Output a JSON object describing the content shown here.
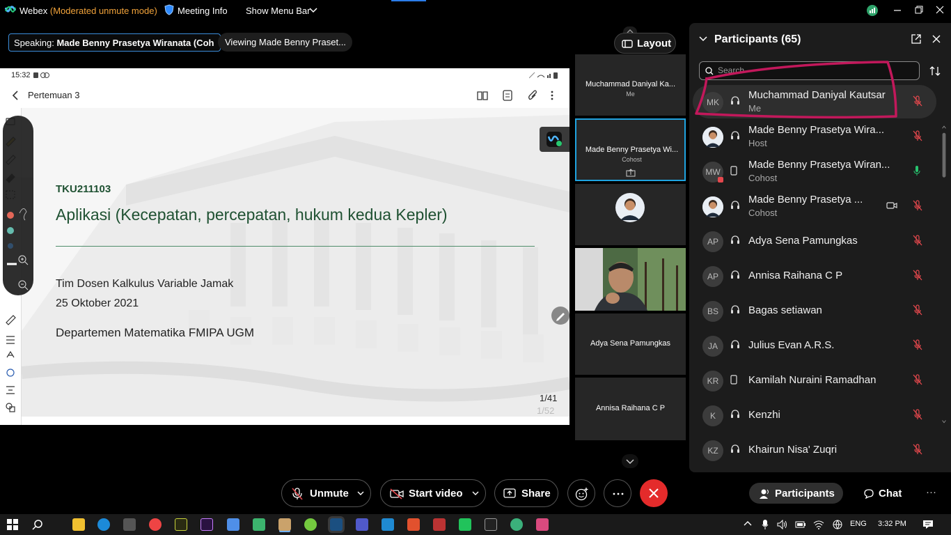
{
  "titlebar": {
    "app": "Webex",
    "mode": "(Moderated unmute mode)",
    "meeting_info": "Meeting Info",
    "show_menu_bar": "Show Menu Bar"
  },
  "speaking": {
    "label": "Speaking:",
    "name": "Made Benny Prasetya Wiranata (Coh"
  },
  "viewing": "Viewing Made Benny Praset...",
  "layout_button": "Layout",
  "shared": {
    "status_time": "15:32",
    "doc_title": "Pertemuan 3",
    "slide": {
      "code": "TKU211103",
      "heading": "Aplikasi (Kecepatan, percepatan, hukum kedua Kepler)",
      "line1": "Tim Dosen Kalkulus Variable Jamak",
      "line2": "25 Oktober 2021",
      "line3": "Departemen Matematika FMIPA UGM",
      "page": "1/41",
      "page_total": "1/52"
    }
  },
  "video_strip": [
    {
      "name": "Muchammad Daniyal Ka...",
      "role": "Me"
    },
    {
      "name": "Made Benny Prasetya Wi...",
      "role": "Cohost"
    },
    {
      "name": "",
      "role": ""
    },
    {
      "name": "",
      "role": ""
    },
    {
      "name": "Adya Sena Pamungkas",
      "role": ""
    },
    {
      "name": "Annisa Raihana C P",
      "role": ""
    }
  ],
  "participants": {
    "title": "Participants (65)",
    "search_placeholder": "Search",
    "list": [
      {
        "initials": "MK",
        "name": "Muchammad Daniyal Kautsar",
        "role": "Me",
        "device": "headset",
        "mic": "muted"
      },
      {
        "initials": "",
        "name": "Made Benny Prasetya Wira...",
        "role": "Host",
        "device": "headset",
        "mic": "muted"
      },
      {
        "initials": "MW",
        "name": "Made Benny Prasetya Wiran...",
        "role": "Cohost",
        "device": "phone",
        "mic": "active"
      },
      {
        "initials": "",
        "name": "Made Benny Prasetya ...",
        "role": "Cohost",
        "device": "headset",
        "mic": "muted"
      },
      {
        "initials": "AP",
        "name": "Adya Sena Pamungkas",
        "role": "",
        "device": "headset",
        "mic": "muted"
      },
      {
        "initials": "AP",
        "name": "Annisa Raihana C P",
        "role": "",
        "device": "headset",
        "mic": "muted"
      },
      {
        "initials": "BS",
        "name": "Bagas setiawan",
        "role": "",
        "device": "headset",
        "mic": "muted"
      },
      {
        "initials": "JA",
        "name": "Julius Evan A.R.S.",
        "role": "",
        "device": "headset",
        "mic": "muted"
      },
      {
        "initials": "KR",
        "name": "Kamilah Nuraini Ramadhan",
        "role": "",
        "device": "phone",
        "mic": "muted"
      },
      {
        "initials": "K",
        "name": "Kenzhi",
        "role": "",
        "device": "headset",
        "mic": "muted"
      },
      {
        "initials": "KZ",
        "name": "Khairun Nisa' Zuqri",
        "role": "",
        "device": "headset",
        "mic": "muted"
      }
    ]
  },
  "controls": {
    "unmute": "Unmute",
    "start_video": "Start video",
    "share": "Share",
    "participants": "Participants",
    "chat": "Chat"
  },
  "taskbar": {
    "lang": "ENG",
    "time": "3:32 PM"
  },
  "colors": {
    "accent_blue": "#1fa3e0",
    "leave_red": "#e42b2b",
    "mute_red": "#e5484d",
    "moderated_orange": "#f2a33a",
    "annotation_magenta": "#c2185b",
    "slide_green": "#1f5132"
  }
}
